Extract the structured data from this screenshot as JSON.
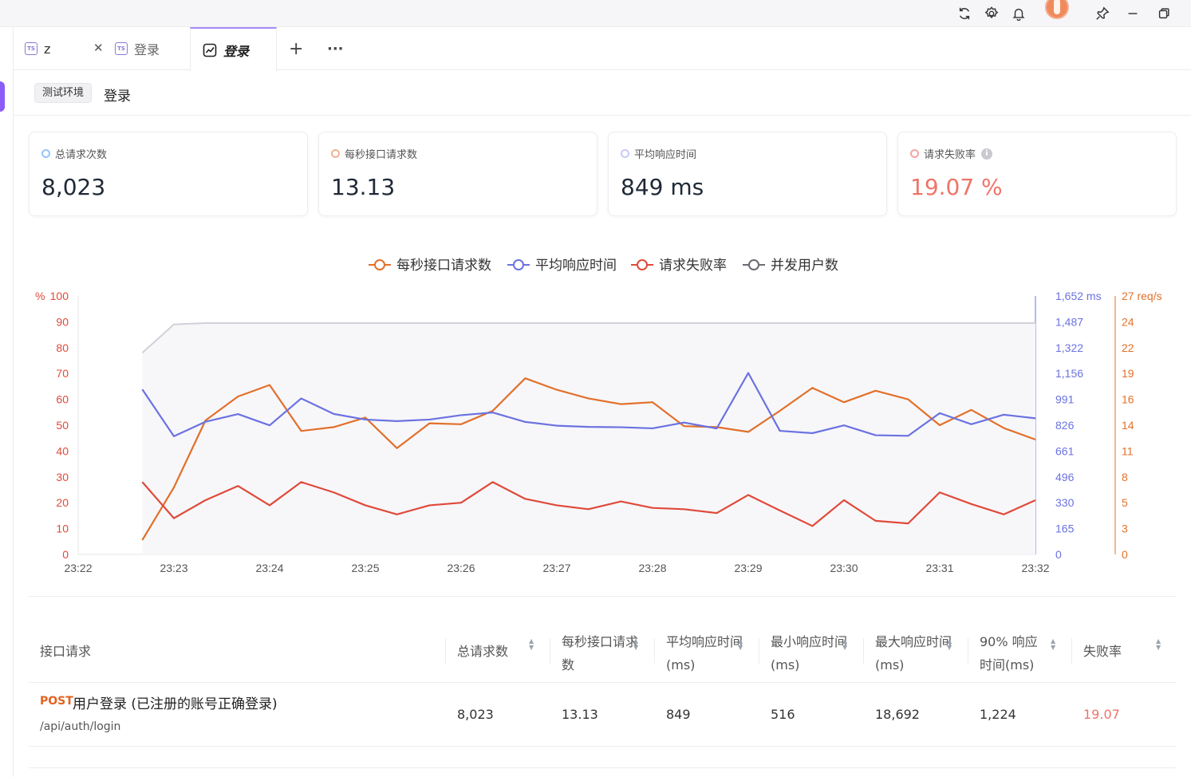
{
  "tabs": [
    {
      "label": "z",
      "badge": "TS"
    },
    {
      "label": "登录",
      "badge": "TS"
    },
    {
      "label": "登录"
    }
  ],
  "env": {
    "tag": "测试环境",
    "name": "登录"
  },
  "stats": [
    {
      "label": "总请求次数",
      "value": "8,023",
      "color": "#60a5fa"
    },
    {
      "label": "每秒接口请求数",
      "value": "13.13",
      "color": "#f08a5d"
    },
    {
      "label": "平均响应时间",
      "value": "849 ms",
      "color": "#a5b4fc"
    },
    {
      "label": "请求失败率",
      "value": "19.07 %",
      "color": "#f07575"
    }
  ],
  "chart_data": {
    "type": "line",
    "legend": [
      "每秒接口请求数",
      "平均响应时间",
      "请求失败率",
      "并发用户数"
    ],
    "colors": {
      "rps": "#e2702a",
      "resp": "#6b72e0",
      "fail": "#e04a3a",
      "users": "#d1d1d9",
      "users_legend": "#6b6b75"
    },
    "x_ticks": [
      "23:22",
      "23:23",
      "23:24",
      "23:25",
      "23:26",
      "23:27",
      "23:28",
      "23:29",
      "23:30",
      "23:31",
      "23:32"
    ],
    "left_axis": {
      "unit": "%",
      "ticks": [
        "100",
        "90",
        "80",
        "70",
        "60",
        "50",
        "40",
        "30",
        "20",
        "10",
        "0"
      ]
    },
    "mid_axis": {
      "ticks": [
        "1,652 ms",
        "1,487",
        "1,322",
        "1,156",
        "991",
        "826",
        "661",
        "496",
        "330",
        "165",
        "0"
      ]
    },
    "right_axis": {
      "ticks": [
        "27 req/s",
        "24",
        "22",
        "19",
        "16",
        "14",
        "11",
        "8",
        "5",
        "3",
        "0"
      ]
    },
    "x_minutes": [
      0.67,
      1.0,
      1.33,
      1.67,
      2.0,
      2.33,
      2.67,
      3.0,
      3.33,
      3.67,
      4.0,
      4.33,
      4.67,
      5.0,
      5.33,
      5.67,
      6.0,
      6.33,
      6.67,
      7.0,
      7.33,
      7.67,
      8.0,
      8.33,
      8.67,
      9.0,
      9.33,
      9.67,
      10.0
    ],
    "series": [
      {
        "name": "每秒接口请求数",
        "key": "rps",
        "axis": "right",
        "max": 27,
        "values": [
          1.5,
          7.0,
          14.0,
          16.5,
          17.7,
          12.9,
          13.3,
          14.3,
          11.1,
          13.7,
          13.6,
          15.0,
          18.4,
          17.2,
          16.3,
          15.7,
          15.9,
          13.4,
          13.3,
          12.8,
          15.0,
          17.4,
          15.9,
          17.1,
          16.2,
          13.5,
          15.1,
          13.2,
          12.0
        ]
      },
      {
        "name": "平均响应时间",
        "key": "resp",
        "axis": "mid",
        "max": 1652,
        "values": [
          1055,
          755,
          848,
          897,
          825,
          997,
          898,
          862,
          852,
          862,
          890,
          907,
          847,
          823,
          815,
          813,
          806,
          843,
          805,
          1160,
          790,
          775,
          825,
          762,
          758,
          903,
          832,
          893,
          870
        ]
      },
      {
        "name": "请求失败率",
        "key": "fail",
        "axis": "left",
        "max": 100,
        "values": [
          28,
          14,
          21,
          26.5,
          19,
          28,
          24,
          19,
          15.5,
          19,
          20,
          28,
          21.5,
          19,
          17.5,
          20.5,
          18,
          17.5,
          16,
          23,
          17,
          11,
          21,
          13,
          12,
          24,
          19.5,
          15.5,
          21
        ]
      },
      {
        "name": "并发用户数",
        "key": "users",
        "axis": "left",
        "max": 100,
        "values": [
          78,
          89,
          89.5,
          89.5,
          89.5,
          89.5,
          89.5,
          89.5,
          89.5,
          89.5,
          89.5,
          89.5,
          89.5,
          89.5,
          89.5,
          89.5,
          89.5,
          89.5,
          89.5,
          89.5,
          89.5,
          89.5,
          89.5,
          89.5,
          89.5,
          89.5,
          89.5,
          89.5,
          89.5
        ]
      }
    ]
  },
  "table": {
    "headers": [
      {
        "label": "接口请求"
      },
      {
        "label": "总请求数"
      },
      {
        "label": "每秒接口请求数"
      },
      {
        "label": "平均响应时间(ms)"
      },
      {
        "label": "最小响应时间(ms)"
      },
      {
        "label": "最大响应时间(ms)"
      },
      {
        "label": "90% 响应时间(ms)"
      },
      {
        "label": "失败率"
      }
    ],
    "rows": [
      {
        "method": "POST",
        "name": "用户登录 (已注册的账号正确登录)",
        "path": "/api/auth/login",
        "total": "8,023",
        "rps": "13.13",
        "avg": "849",
        "min": "516",
        "max": "18,692",
        "p90": "1,224",
        "fail": "19.07"
      }
    ]
  }
}
